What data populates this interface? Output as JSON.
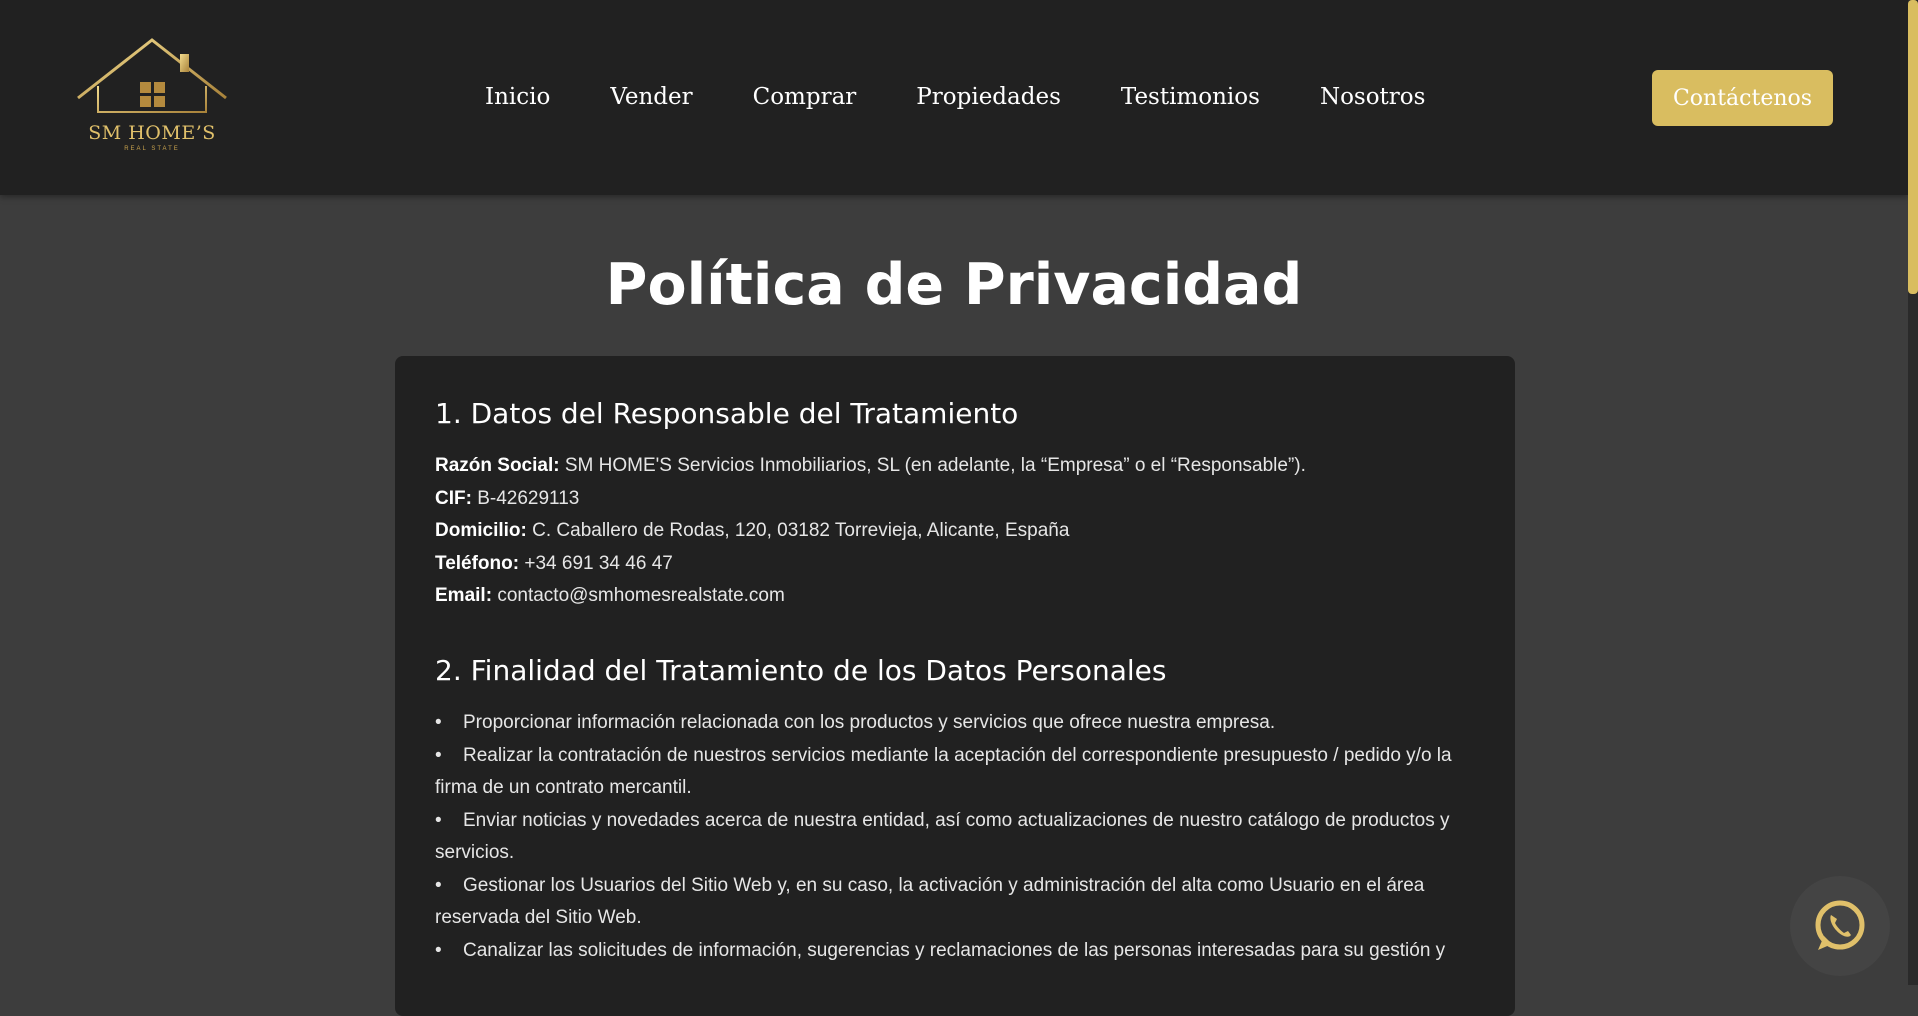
{
  "header": {
    "logo": {
      "name": "SM HOME’S",
      "tagline": "REAL STATE"
    },
    "nav": [
      {
        "label": "Inicio"
      },
      {
        "label": "Vender"
      },
      {
        "label": "Comprar"
      },
      {
        "label": "Propiedades"
      },
      {
        "label": "Testimonios"
      },
      {
        "label": "Nosotros"
      }
    ],
    "cta_label": "Contáctenos"
  },
  "page": {
    "title": "Política de Privacidad"
  },
  "section1": {
    "heading": "1. Datos del Responsable del Tratamiento",
    "fields": [
      {
        "label": "Razón Social:",
        "value": "SM HOME'S Servicios Inmobiliarios, SL (en adelante, la “Empresa” o el “Responsable”)."
      },
      {
        "label": "CIF:",
        "value": "B-42629113"
      },
      {
        "label": "Domicilio:",
        "value": "C. Caballero de Rodas, 120, 03182 Torrevieja, Alicante, España"
      },
      {
        "label": "Teléfono:",
        "value": "+34 691 34 46 47"
      },
      {
        "label": "Email:",
        "value": "contacto@smhomesrealstate.com"
      }
    ]
  },
  "section2": {
    "heading": "2. Finalidad del Tratamiento de los Datos Personales",
    "items": [
      "Proporcionar información relacionada con los productos y servicios que ofrece nuestra empresa.",
      "Realizar la contratación de nuestros servicios mediante la aceptación del correspondiente presupuesto / pedido y/o la firma de un contrato mercantil.",
      "Enviar noticias y novedades acerca de nuestra entidad, así como actualizaciones de nuestro catálogo de productos y servicios.",
      "Gestionar los Usuarios del Sitio Web y, en su caso, la activación y administración del alta como Usuario en el área reservada del Sitio Web.",
      "Canalizar las solicitudes de información, sugerencias y reclamaciones de las personas interesadas para su gestión y"
    ]
  },
  "icons": {
    "logo_house": "house-logo-icon",
    "whatsapp": "whatsapp-icon"
  },
  "colors": {
    "header_bg": "#212121",
    "page_bg": "#3d3d3d",
    "accent": "#d9bd60",
    "card_bg": "#212121"
  }
}
